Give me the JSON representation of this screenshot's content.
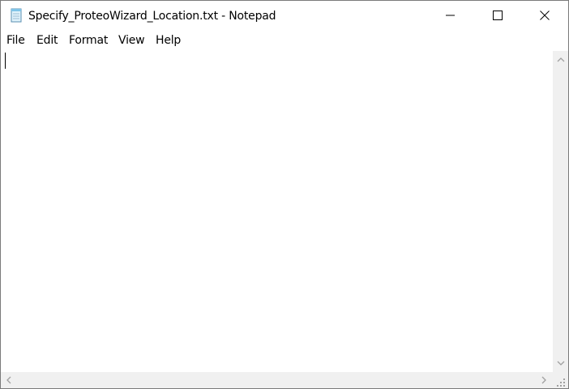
{
  "window": {
    "title": "Specify_ProteoWizard_Location.txt - Notepad",
    "app_icon": "notepad-icon"
  },
  "title_buttons": {
    "minimize_icon": "minimize-icon",
    "maximize_icon": "maximize-icon",
    "close_icon": "close-icon"
  },
  "menu": {
    "items": [
      "File",
      "Edit",
      "Format",
      "View",
      "Help"
    ]
  },
  "editor": {
    "content": ""
  },
  "colors": {
    "scrollbar_bg": "#f0f0f0",
    "arrow": "#a0a0a0",
    "border": "#7a7a7a"
  }
}
